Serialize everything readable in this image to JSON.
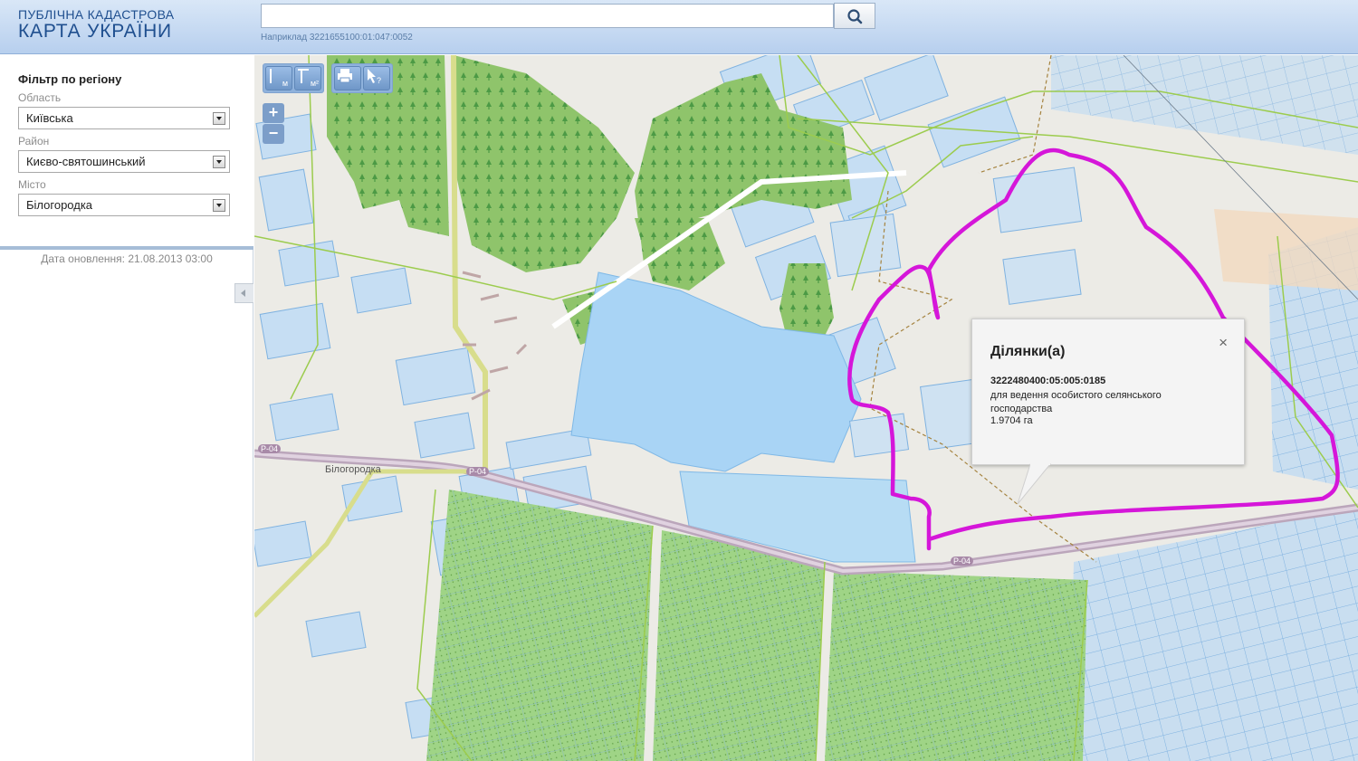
{
  "header": {
    "logo_line1": "ПУБЛІЧНА КАДАСТРОВА",
    "logo_line2": "КАРТА УКРАЇНИ",
    "search_value": "",
    "search_hint": "Наприклад 3221655100:01:047:0052",
    "search_icon": "search-icon"
  },
  "sidebar": {
    "filter_title": "Фільтр по регіону",
    "fields": [
      {
        "label": "Область",
        "value": "Київська"
      },
      {
        "label": "Район",
        "value": "Києво-святошинський"
      },
      {
        "label": "Місто",
        "value": "Білогородка"
      }
    ],
    "update_date": "Дата оновлення: 21.08.2013 03:00"
  },
  "toolbar": {
    "measure_length_label": "м",
    "measure_area_label": "м²",
    "print_icon": "print-icon",
    "identify_icon": "identify-icon"
  },
  "zoom": {
    "in_label": "+",
    "out_label": "−"
  },
  "map": {
    "place_label": "Білогородка",
    "road_labels": [
      "Р-04",
      "Р-04",
      "Р-04"
    ],
    "highlight_color": "#d516d9"
  },
  "popup": {
    "title": "Ділянки(а)",
    "close_label": "×",
    "cadastral_number": "3222480400:05:005:0185",
    "purpose": "для ведення особистого селянського господарства",
    "area": "1.9704 га"
  }
}
